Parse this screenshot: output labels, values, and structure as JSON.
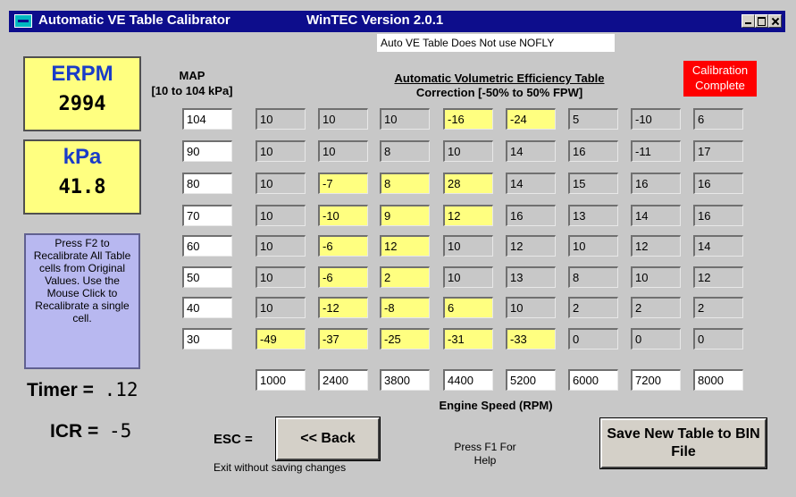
{
  "window": {
    "title": "Automatic VE Table Calibrator",
    "version": "WinTEC Version 2.0.1"
  },
  "note": "Auto VE Table Does Not use NOFLY",
  "erpm": {
    "label": "ERPM",
    "value": "2994"
  },
  "kpa": {
    "label": "kPa",
    "value": "41.8"
  },
  "help_text": "Press F2 to Recalibrate All Table cells from Original Values. Use the Mouse Click to Recalibrate a single cell.",
  "map": {
    "label": "MAP",
    "range": "[10 to 104 kPa]"
  },
  "table_header": {
    "title": "Automatic Volumetric Efficiency Table",
    "subtitle": "Correction [-50% to 50% FPW]"
  },
  "status": "Calibration Complete",
  "map_values": [
    "104",
    "90",
    "80",
    "70",
    "60",
    "50",
    "40",
    "30"
  ],
  "ve_table": [
    [
      {
        "v": "10",
        "changed": false
      },
      {
        "v": "10",
        "changed": false
      },
      {
        "v": "10",
        "changed": false
      },
      {
        "v": "-16",
        "changed": true
      },
      {
        "v": "-24",
        "changed": true
      },
      {
        "v": "5",
        "changed": false
      },
      {
        "v": "-10",
        "changed": false
      },
      {
        "v": "6",
        "changed": false
      }
    ],
    [
      {
        "v": "10",
        "changed": false
      },
      {
        "v": "10",
        "changed": false
      },
      {
        "v": "8",
        "changed": false
      },
      {
        "v": "10",
        "changed": false
      },
      {
        "v": "14",
        "changed": false
      },
      {
        "v": "16",
        "changed": false
      },
      {
        "v": "-11",
        "changed": false
      },
      {
        "v": "17",
        "changed": false
      }
    ],
    [
      {
        "v": "10",
        "changed": false
      },
      {
        "v": "-7",
        "changed": true
      },
      {
        "v": "8",
        "changed": true
      },
      {
        "v": "28",
        "changed": true
      },
      {
        "v": "14",
        "changed": false
      },
      {
        "v": "15",
        "changed": false
      },
      {
        "v": "16",
        "changed": false
      },
      {
        "v": "16",
        "changed": false
      }
    ],
    [
      {
        "v": "10",
        "changed": false
      },
      {
        "v": "-10",
        "changed": true
      },
      {
        "v": "9",
        "changed": true
      },
      {
        "v": "12",
        "changed": true
      },
      {
        "v": "16",
        "changed": false
      },
      {
        "v": "13",
        "changed": false
      },
      {
        "v": "14",
        "changed": false
      },
      {
        "v": "16",
        "changed": false
      }
    ],
    [
      {
        "v": "10",
        "changed": false
      },
      {
        "v": "-6",
        "changed": true
      },
      {
        "v": "12",
        "changed": true
      },
      {
        "v": "10",
        "changed": false
      },
      {
        "v": "12",
        "changed": false
      },
      {
        "v": "10",
        "changed": false
      },
      {
        "v": "12",
        "changed": false
      },
      {
        "v": "14",
        "changed": false
      }
    ],
    [
      {
        "v": "10",
        "changed": false
      },
      {
        "v": "-6",
        "changed": true
      },
      {
        "v": "2",
        "changed": true
      },
      {
        "v": "10",
        "changed": false
      },
      {
        "v": "13",
        "changed": false
      },
      {
        "v": "8",
        "changed": false
      },
      {
        "v": "10",
        "changed": false
      },
      {
        "v": "12",
        "changed": false
      }
    ],
    [
      {
        "v": "10",
        "changed": false
      },
      {
        "v": "-12",
        "changed": true
      },
      {
        "v": "-8",
        "changed": true
      },
      {
        "v": "6",
        "changed": true
      },
      {
        "v": "10",
        "changed": false
      },
      {
        "v": "2",
        "changed": false
      },
      {
        "v": "2",
        "changed": false
      },
      {
        "v": "2",
        "changed": false
      }
    ],
    [
      {
        "v": "-49",
        "changed": true
      },
      {
        "v": "-37",
        "changed": true
      },
      {
        "v": "-25",
        "changed": true
      },
      {
        "v": "-31",
        "changed": true
      },
      {
        "v": "-33",
        "changed": true
      },
      {
        "v": "0",
        "changed": false
      },
      {
        "v": "0",
        "changed": false
      },
      {
        "v": "0",
        "changed": false
      }
    ]
  ],
  "rpm_values": [
    "1000",
    "2400",
    "3800",
    "4400",
    "5200",
    "6000",
    "7200",
    "8000"
  ],
  "rpm_label": "Engine Speed (RPM)",
  "timer": {
    "label": "Timer =",
    "value": ".12"
  },
  "icr": {
    "label": "ICR =",
    "value": "-5"
  },
  "esc": {
    "label": "ESC =",
    "hint": "Exit without saving changes"
  },
  "back_button": "<< Back",
  "f1_hint": "Press F1 For Help",
  "save_button": "Save New Table to BIN File",
  "colors": {
    "titlebar": "#0d0d8c",
    "changed_cell": "#ffff80",
    "status_bg": "#ff0000",
    "help_bg": "#b8b8f0",
    "label_blue": "#1a3cc8"
  }
}
